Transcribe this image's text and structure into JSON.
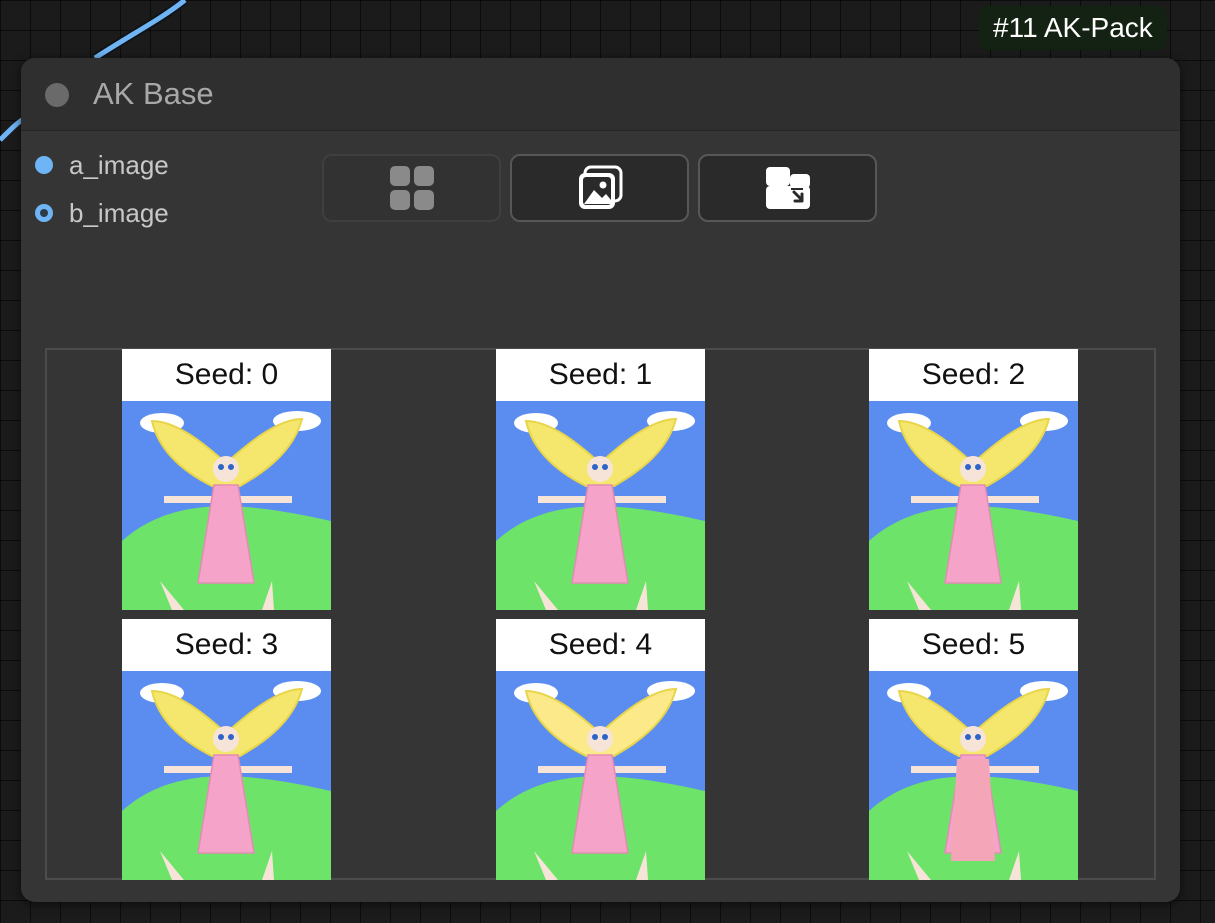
{
  "badge": {
    "label": "#11 AK-Pack"
  },
  "node": {
    "title": "AK Base",
    "inputs": [
      {
        "name": "a_image"
      },
      {
        "name": "b_image"
      }
    ],
    "toolbar": [
      {
        "icon": "grid-icon"
      },
      {
        "icon": "image-icon"
      },
      {
        "icon": "compare-icon"
      }
    ],
    "gallery": {
      "items": [
        {
          "label": "Seed: 0"
        },
        {
          "label": "Seed: 1"
        },
        {
          "label": "Seed: 2"
        },
        {
          "label": "Seed: 3"
        },
        {
          "label": "Seed: 4"
        },
        {
          "label": "Seed: 5"
        }
      ]
    }
  },
  "colors": {
    "wire": "#6fb5f5",
    "badge_bg": "#142214",
    "node_bg": "#353535",
    "sky": "#5b8df0",
    "grass": "#6de36a",
    "hair": "#f5e66e",
    "dress": "#f5a3c8"
  }
}
